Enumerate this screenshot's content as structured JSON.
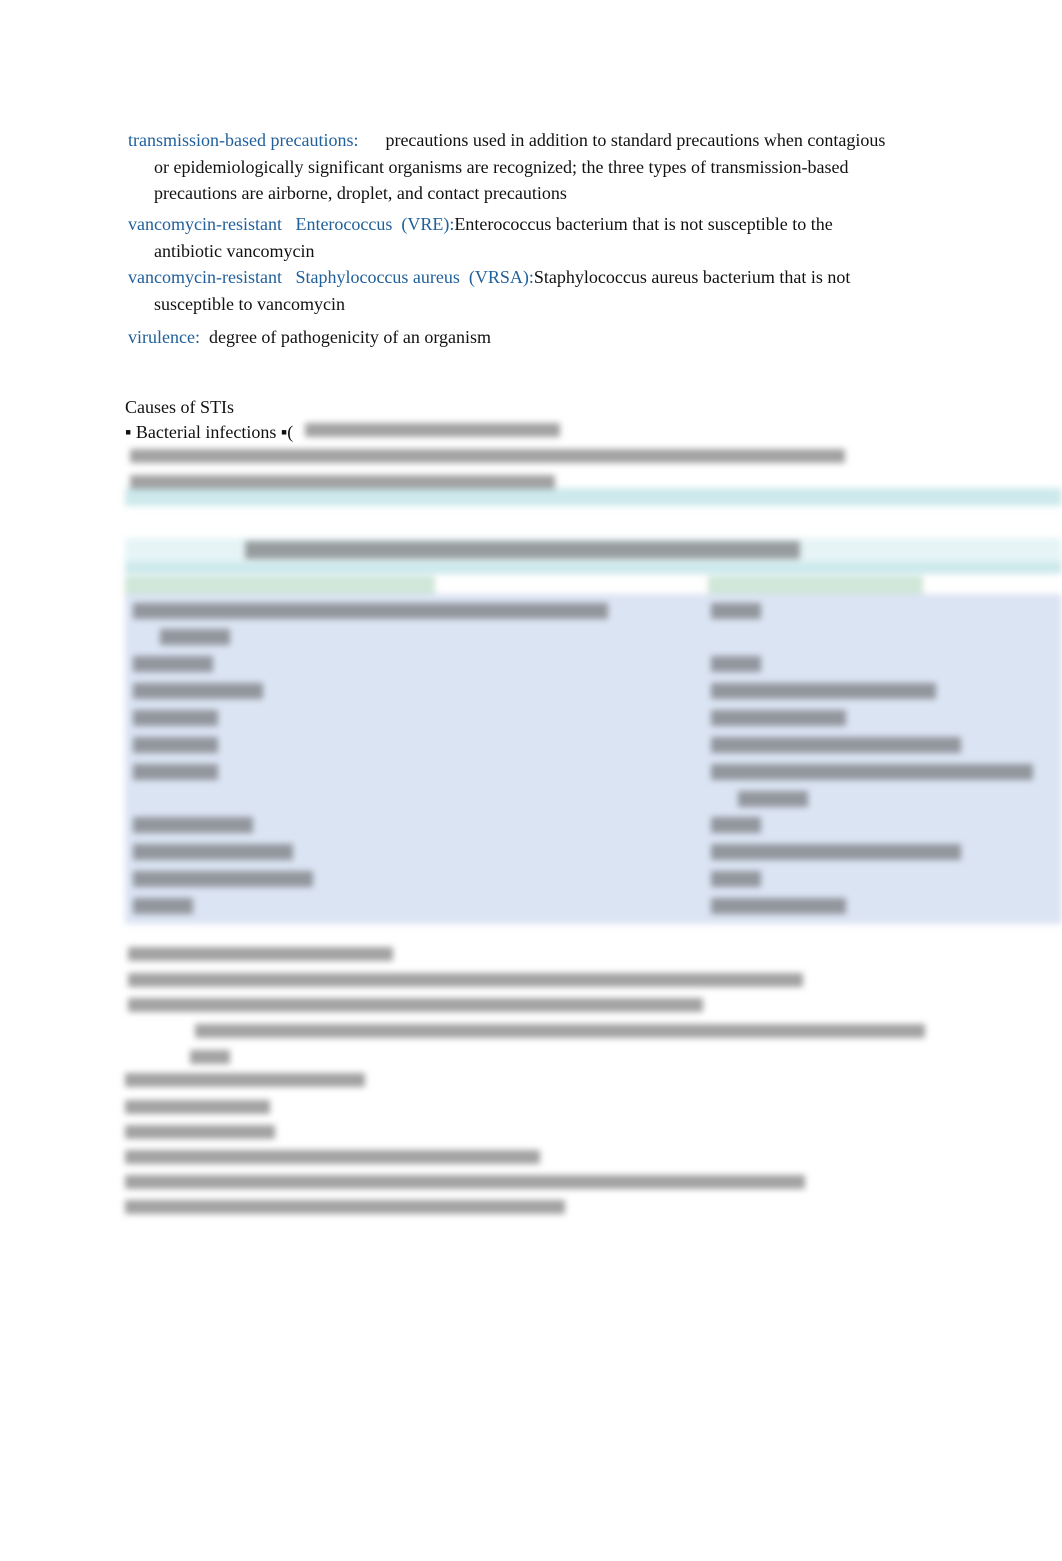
{
  "glossary": [
    {
      "term": "transmission-based precautions:",
      "first": "precautions used in addition to standard precautions when contagious",
      "rest": "or epidemiologically significant organisms are recognized; the three types of transmission-based precautions are airborne, droplet, and contact precautions"
    },
    {
      "term": "vancomycin-resistant   Enterococcus  (VRE):",
      "first": "Enterococcus bacterium that is not susceptible to the",
      "rest": "antibiotic vancomycin"
    },
    {
      "term": "vancomycin-resistant   Staphylococcus aureus  (VRSA):",
      "first": "Staphylococcus aureus bacterium that is not",
      "rest": "susceptible to vancomycin"
    },
    {
      "term": "virulence:",
      "first": "degree of pathogenicity of an organism",
      "rest": ""
    }
  ],
  "section": {
    "heading": "Causes of STIs",
    "bullet": "▪ Bacterial infections ▪("
  },
  "colors": {
    "term": "#1f5f9a",
    "table_bg": "#dbe4f3",
    "table_header": "#cfe6d8",
    "band": "#cde9ec"
  }
}
